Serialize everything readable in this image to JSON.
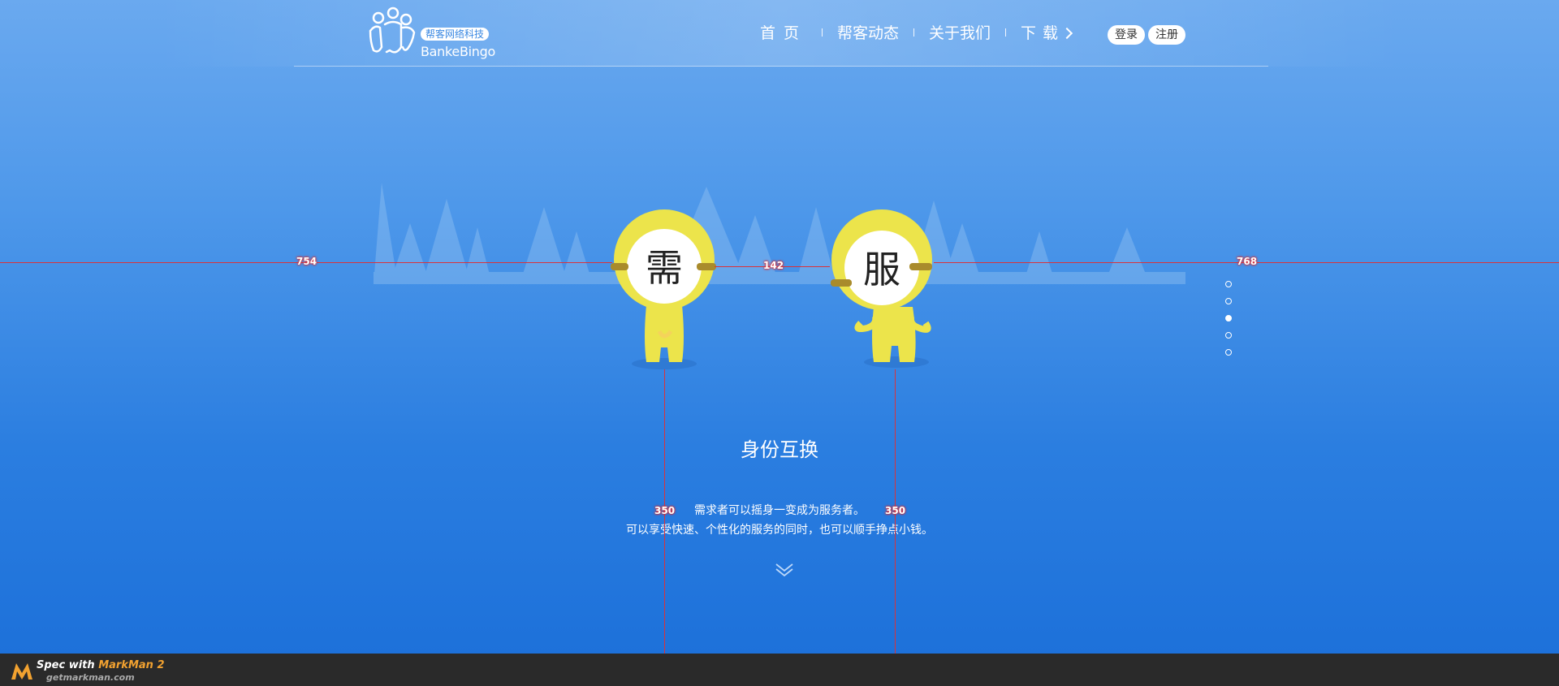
{
  "header": {
    "logo_cn": "帮客网络科技",
    "logo_en": "BankeBingo",
    "nav": [
      "首页",
      "帮客动态",
      "关于我们",
      "下载"
    ],
    "login": "登录",
    "register": "注册"
  },
  "hero": {
    "figure_left_char": "需",
    "figure_right_char": "服",
    "title": "身份互换",
    "line1": "需求者可以摇身一变成为服务者。",
    "line2": "可以享受快速、个性化的服务的同时，也可以顺手挣点小钱。",
    "active_slide": 3,
    "slide_count": 5
  },
  "measurements": {
    "left": "754",
    "gap": "142",
    "right": "768",
    "left_v": "350",
    "right_v": "350"
  },
  "footer": {
    "spec_prefix": "Spec with ",
    "spec_brand": "MarkMan 2",
    "url": "getmarkman.com"
  },
  "colors": {
    "bg_top": "#6aa9ef",
    "bg_bottom": "#1b6fd9",
    "figure_yellow": "#ece44b",
    "measure_red": "#d9323b",
    "footer_bg": "#2a2a2a",
    "brand_orange": "#f2a230"
  }
}
